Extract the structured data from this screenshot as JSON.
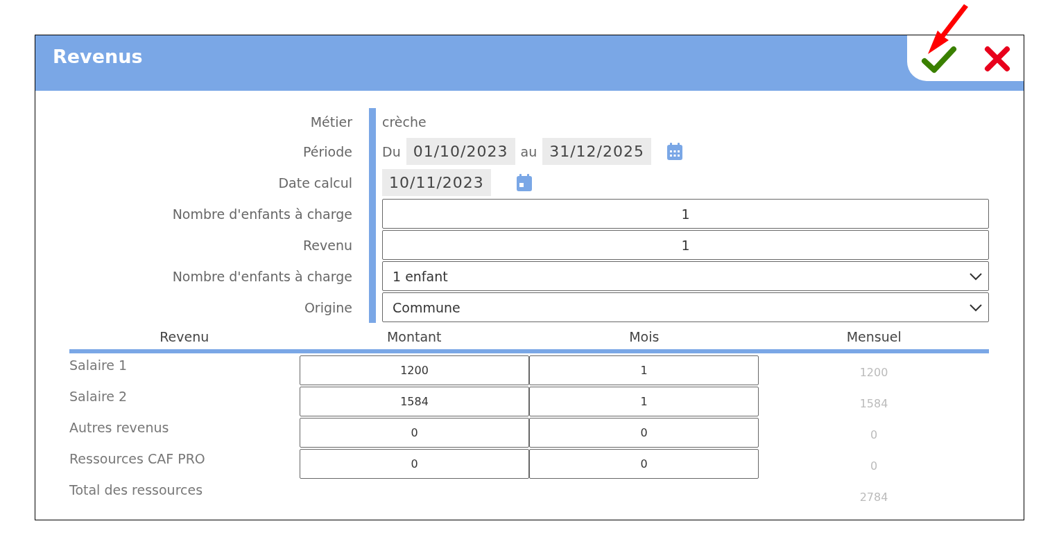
{
  "dialog": {
    "title": "Revenus"
  },
  "fields": [
    {
      "kind": "text",
      "label": "Métier",
      "value": "crèche"
    },
    {
      "kind": "period",
      "label": "Période",
      "from_label": "Du",
      "from": "01/10/2023",
      "to_label": "au",
      "to": "31/12/2025"
    },
    {
      "kind": "date",
      "label": "Date calcul",
      "value": "10/11/2023"
    },
    {
      "kind": "input",
      "label": "Nombre d'enfants à charge",
      "value": "1"
    },
    {
      "kind": "input",
      "label": "Revenu",
      "value": "1"
    },
    {
      "kind": "select",
      "label": "Nombre d'enfants à charge",
      "value": "1 enfant"
    },
    {
      "kind": "select",
      "label": "Origine",
      "value": "Commune"
    }
  ],
  "table": {
    "columns": [
      "Revenu",
      "Montant",
      "Mois",
      "Mensuel"
    ],
    "rows": [
      {
        "label": "Salaire 1",
        "montant": "1200",
        "mois": "1",
        "mensuel": "1200"
      },
      {
        "label": "Salaire 2",
        "montant": "1584",
        "mois": "1",
        "mensuel": "1584"
      },
      {
        "label": "Autres revenus",
        "montant": "0",
        "mois": "0",
        "mensuel": "0"
      },
      {
        "label": "Ressources CAF PRO",
        "montant": "0",
        "mois": "0",
        "mensuel": "0"
      }
    ],
    "total": {
      "label": "Total des ressources",
      "mensuel": "2784"
    }
  }
}
